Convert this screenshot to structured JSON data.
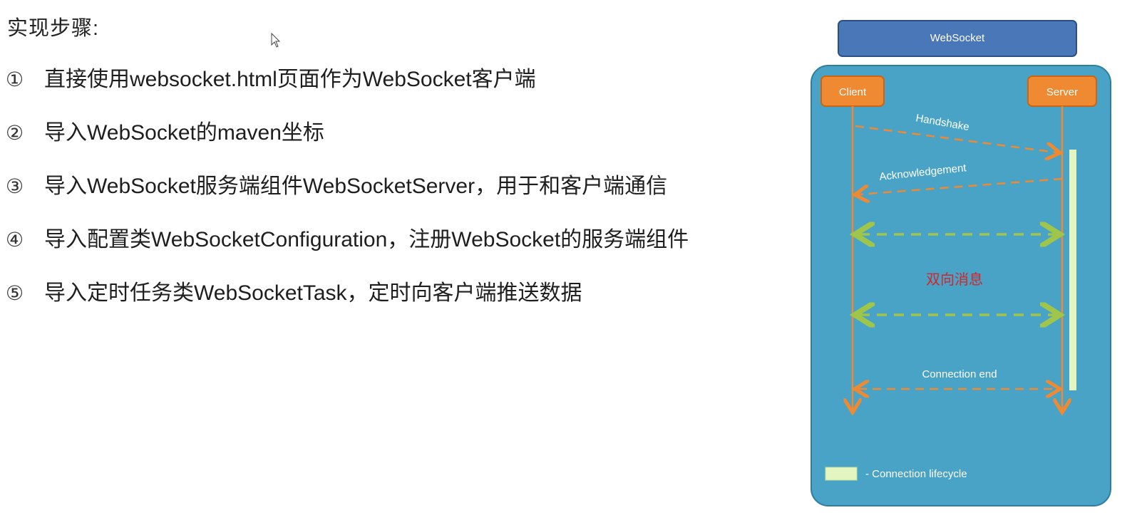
{
  "steps_title": "实现步骤:",
  "steps": [
    {
      "num": "①",
      "text": "直接使用websocket.html页面作为WebSocket客户端"
    },
    {
      "num": "②",
      "text": "导入WebSocket的maven坐标"
    },
    {
      "num": "③",
      "text": "导入WebSocket服务端组件WebSocketServer，用于和客户端通信"
    },
    {
      "num": "④",
      "text": "导入配置类WebSocketConfiguration，注册WebSocket的服务端组件"
    },
    {
      "num": "⑤",
      "text": "导入定时任务类WebSocketTask，定时向客户端推送数据"
    }
  ],
  "diagram": {
    "title": "WebSocket",
    "client_label": "Client",
    "server_label": "Server",
    "handshake": "Handshake",
    "acknowledgement": "Acknowledgement",
    "bidirectional": "双向消息",
    "connection_end": "Connection end",
    "legend": "- Connection lifecycle",
    "colors": {
      "title_box": "#4a77b8",
      "panel": "#48a3c6",
      "node": "#f08a32",
      "arrow_orange": "#f08a32",
      "arrow_green": "#9fc54b",
      "lifecycle": "#e3f5c0",
      "bidirectional_text": "#d1262a"
    }
  }
}
